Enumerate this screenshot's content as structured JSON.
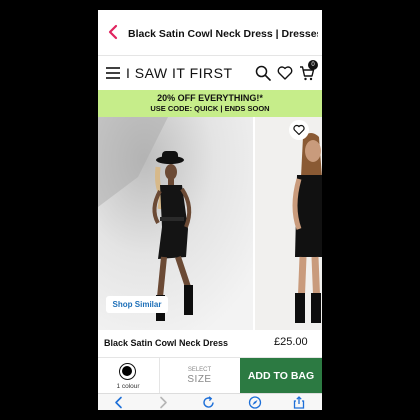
{
  "browser": {
    "page_title": "Black Satin Cowl Neck Dress | Dresses..."
  },
  "header": {
    "brand": "I SAW IT FIRST",
    "bag_count": "0"
  },
  "promo": {
    "title": "20% OFF EVERYTHING!*",
    "code_line": "USE CODE: QUICK | ENDS SOON"
  },
  "gallery": {
    "shop_similar_label": "Shop Similar"
  },
  "product": {
    "name": "Black Satin Cowl Neck Dress",
    "price": "£25.00"
  },
  "purchase": {
    "colour_label": "1 colour",
    "size_top": "SELECT",
    "size_bottom": "SIZE",
    "add_to_bag": "ADD TO BAG"
  },
  "colors": {
    "promo_bg": "#c6ed8a",
    "add_button_bg": "#2c7a42",
    "back_arrow": "#e0245e",
    "toolbar_icon": "#1d6fd8",
    "shop_similar_text": "#1d6fb8"
  },
  "icons": {
    "back": "back-arrow-icon",
    "menu": "hamburger-menu-icon",
    "search": "search-icon",
    "wishlist": "heart-icon",
    "bag": "shopping-bag-icon",
    "toolbar": [
      "back-icon",
      "forward-icon",
      "reload-icon",
      "compass-icon",
      "share-icon"
    ]
  }
}
